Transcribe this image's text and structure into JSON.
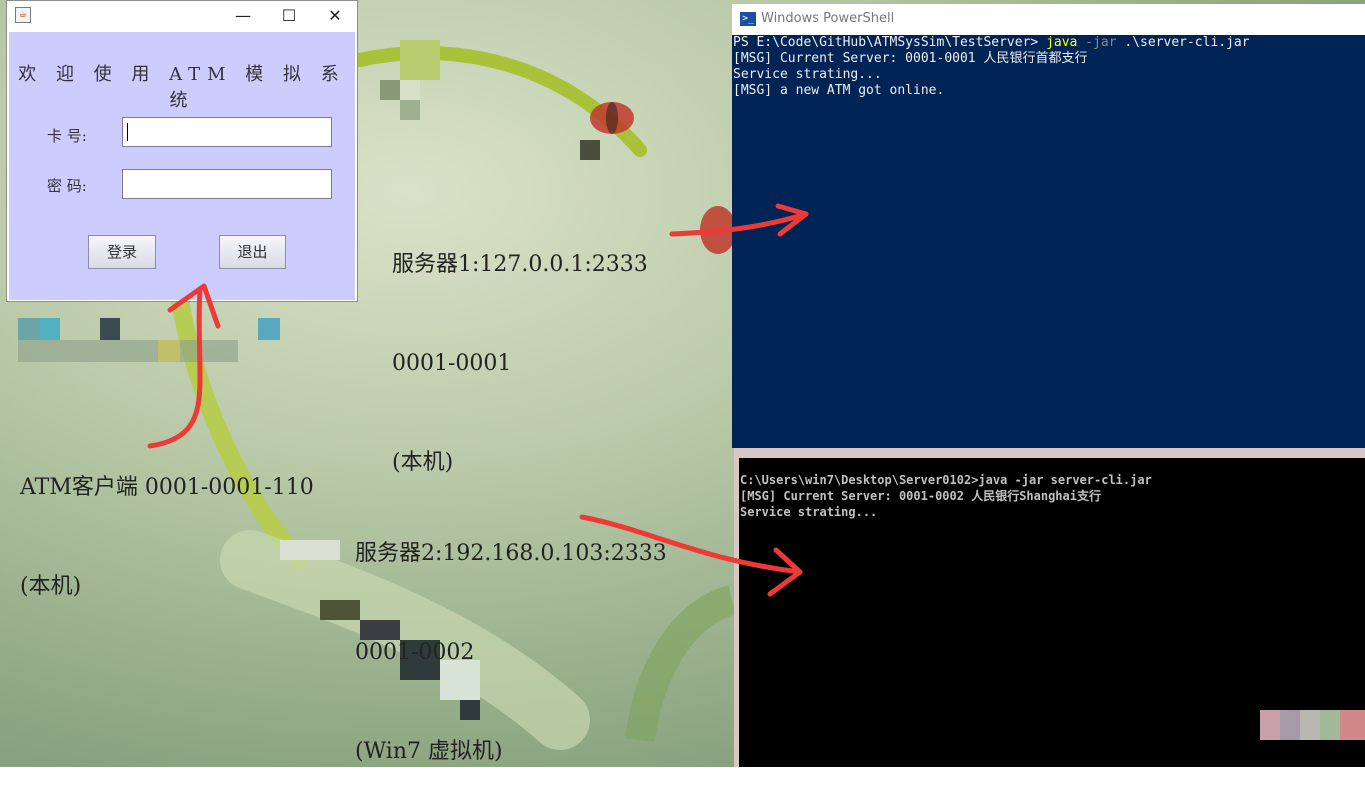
{
  "atm_window": {
    "title_icon": "java-icon",
    "minimize": "—",
    "maximize": "☐",
    "close": "✕",
    "heading": "欢 迎 使 用 ATM 模 拟 系 统",
    "card_label": "卡 号:",
    "card_value": "",
    "password_label": "密 码:",
    "password_value": "",
    "login_button": "登录",
    "exit_button": "退出"
  },
  "annotations": {
    "server1_line1": "服务器1:127.0.0.1:2333",
    "server1_line2": "0001-0001",
    "server1_line3": "(本机)",
    "client_line1": "ATM客户端 0001-0001-110",
    "client_line2": "(本机)",
    "server2_line1": "服务器2:192.168.0.103:2333",
    "server2_line2": "0001-0002",
    "server2_line3": "(Win7 虚拟机)"
  },
  "powershell": {
    "title": "Windows PowerShell",
    "prompt": "PS E:\\Code\\GitHub\\ATMSysSim\\TestServer> ",
    "cmd_java": "java",
    "cmd_flag": " -jar",
    "cmd_rest": " .\\server-cli.jar",
    "line2": "[MSG] Current Server: 0001-0001 人民银行首都支行",
    "line3": "Service strating...",
    "line4": "[MSG] a new ATM got online."
  },
  "cmd": {
    "line1": "C:\\Users\\win7\\Desktop\\Server0102>java -jar server-cli.jar",
    "line2": "[MSG] Current Server: 0001-0002 人民银行Shanghai支行",
    "line3": "Service strating..."
  },
  "colors": {
    "ps_background": "#012456",
    "ps_command": "#ffff00",
    "atm_background": "#ccccff",
    "arrow": "#ee3a36"
  }
}
